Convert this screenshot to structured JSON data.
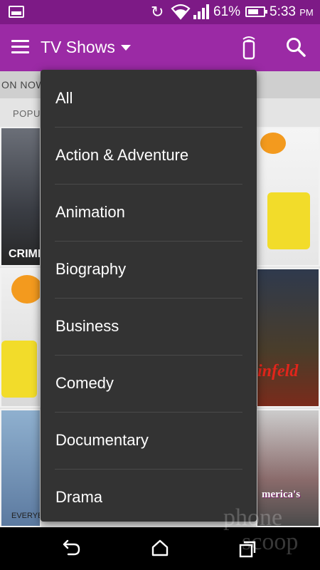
{
  "status_bar": {
    "battery_percent": "61%",
    "time": "5:33",
    "time_suffix": "PM",
    "icons": [
      "gallery-notification-icon",
      "sync-icon",
      "wifi-icon",
      "signal-icon",
      "battery-icon"
    ]
  },
  "action_bar": {
    "title": "TV Shows",
    "icons": [
      "menu-icon",
      "chevron-down-icon",
      "remote-icon",
      "search-icon"
    ]
  },
  "background": {
    "now_tab": "ON NOW",
    "section_label": "POPUL",
    "tiles": [
      {
        "caption": "CRIMIN"
      },
      {
        "caption": ""
      },
      {
        "caption": ""
      },
      {
        "caption": "infeld"
      },
      {
        "caption": "EVERYBOD"
      },
      {
        "caption": "merica's"
      }
    ]
  },
  "dropdown": {
    "items": [
      "All",
      "Action & Adventure",
      "Animation",
      "Biography",
      "Business",
      "Comedy",
      "Documentary",
      "Drama"
    ]
  },
  "nav_bar": {
    "icons": [
      "back-icon",
      "home-icon",
      "recent-apps-icon"
    ]
  },
  "watermark": {
    "text_line1": "phone",
    "text_line2": "scoop"
  }
}
